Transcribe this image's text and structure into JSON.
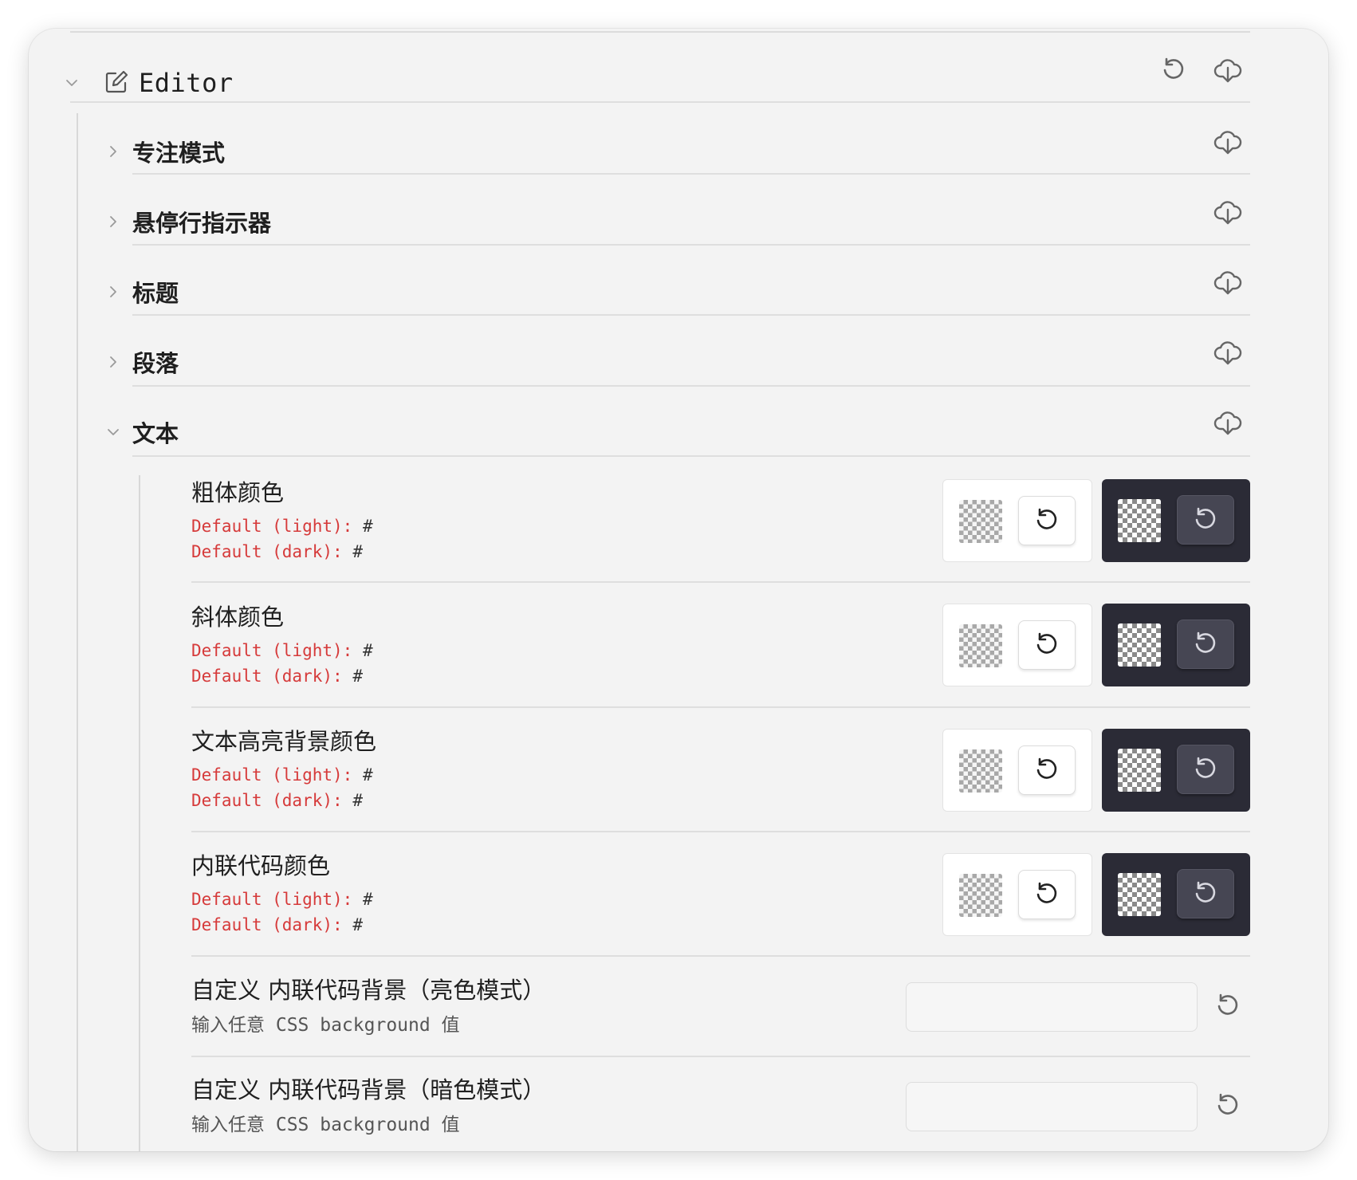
{
  "editor": {
    "title": "Editor",
    "icons": {
      "collapse": "chevron-down-icon",
      "edit": "edit-square-icon",
      "reset": "reset-icon",
      "download": "cloud-download-icon"
    }
  },
  "sections": [
    {
      "label": "专注模式",
      "expanded": false
    },
    {
      "label": "悬停行指示器",
      "expanded": false
    },
    {
      "label": "标题",
      "expanded": false
    },
    {
      "label": "段落",
      "expanded": false
    },
    {
      "label": "文本",
      "expanded": true
    }
  ],
  "text_settings": {
    "default_light_label": "Default (light):",
    "default_dark_label": "Default (dark):",
    "default_value": "#",
    "color_items": [
      {
        "title": "粗体颜色"
      },
      {
        "title": "斜体颜色"
      },
      {
        "title": "文本高亮背景颜色"
      },
      {
        "title": "内联代码颜色"
      }
    ],
    "custom_items": [
      {
        "title": "自定义 内联代码背景（亮色模式）",
        "description": "输入任意 CSS background 值",
        "value": ""
      },
      {
        "title": "自定义 内联代码背景（暗色模式）",
        "description": "输入任意 CSS background 值",
        "value": ""
      }
    ]
  },
  "colors": {
    "accent_red": "#d63a3a",
    "dark_panel": "#2b2b36",
    "background": "#f3f3f3"
  }
}
